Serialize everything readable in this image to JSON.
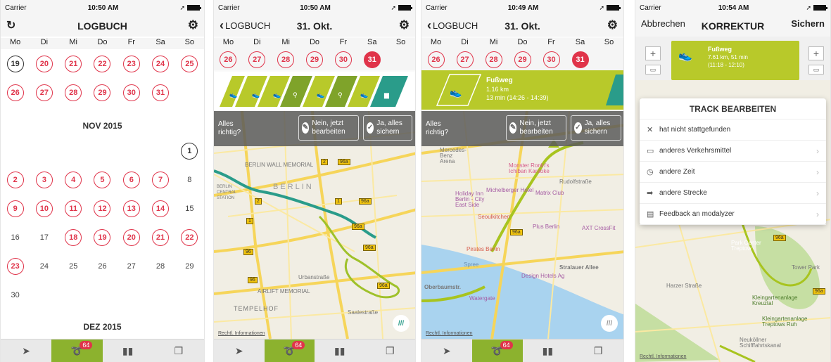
{
  "status": {
    "carrier": "Carrier",
    "times": [
      "10:50 AM",
      "10:50 AM",
      "10:49 AM",
      "10:54 AM"
    ]
  },
  "icons": {
    "refresh": "refresh-icon",
    "gear": "gear-icon",
    "back": "chevron-left-icon",
    "location": "location-icon",
    "track": "track-icon",
    "stats": "bar-chart-icon",
    "pages": "pages-icon"
  },
  "colors": {
    "accent_red": "#e0344a",
    "accent_green": "#8cb22e",
    "walk_green": "#b8c92a",
    "route_teal": "#2a9c8a"
  },
  "weekdays": [
    "Mo",
    "Di",
    "Mi",
    "Do",
    "Fr",
    "Sa",
    "So"
  ],
  "screen1": {
    "title": "LOGBUCH",
    "oct_rows": [
      [
        "19",
        "20",
        "21",
        "22",
        "23",
        "24",
        "25"
      ],
      [
        "26",
        "27",
        "28",
        "29",
        "30",
        "31",
        ""
      ]
    ],
    "nov_title": "NOV 2015",
    "nov_rows": [
      [
        "",
        "",
        "",
        "",
        "",
        "",
        "1"
      ],
      [
        "2",
        "3",
        "4",
        "5",
        "6",
        "7",
        "8"
      ],
      [
        "9",
        "10",
        "11",
        "12",
        "13",
        "14",
        "15"
      ],
      [
        "16",
        "17",
        "18",
        "19",
        "20",
        "21",
        "22"
      ],
      [
        "23",
        "24",
        "25",
        "26",
        "27",
        "28",
        "29"
      ],
      [
        "30",
        "",
        "",
        "",
        "",
        "",
        ""
      ]
    ],
    "dec_title": "DEZ 2015",
    "badge": "64"
  },
  "screen2": {
    "back": "LOGBUCH",
    "title": "31. Okt.",
    "days": [
      "26",
      "27",
      "28",
      "29",
      "30",
      "31"
    ],
    "question": "Alles richtig?",
    "btn_edit": "Nein, jetzt bearbeiten",
    "btn_save": "Ja, alles sichern",
    "map_labels": {
      "berlin": "BERLIN",
      "wall": "BERLIN WALL MEMORIAL",
      "central": "BERLIN CENTRAL STATION",
      "airlift": "AIRLIFT MEMORIAL",
      "tempelhof": "TEMPELHOF",
      "urbanstr": "Urbanstraße",
      "saalestr": "Saalestraße"
    },
    "credits": "Rechtl. Informationen",
    "badge": "64"
  },
  "screen3": {
    "back": "LOGBUCH",
    "title": "31. Okt.",
    "days": [
      "26",
      "27",
      "28",
      "29",
      "30",
      "31"
    ],
    "walk_title": "Fußweg",
    "walk_dist": "1.16 km",
    "walk_time": "13 min (14:26 - 14:39)",
    "question": "Alles richtig?",
    "btn_edit": "Nein, jetzt bearbeiten",
    "btn_save": "Ja, alles sichern",
    "map_labels": {
      "mercedes": "Mercedes-Benz Arena",
      "monster": "Monster Ronin's Ichiban Karaoke",
      "holiday": "Holiday Inn Berlin - City East Side",
      "michelberger": "Michelberger Hotel",
      "matrix": "Matrix Club",
      "seoul": "Seoulkitchen",
      "plus": "Plus Berlin",
      "axt": "AXT CrossFit",
      "pirates": "Pirates Berlin",
      "spree": "Spree",
      "design": "Design Hotels Ag",
      "stralauer": "Stralauer Allee",
      "oberbaum": "Oberbaumstr.",
      "watergate": "Watergate",
      "rudolf": "Rudolfstraße"
    },
    "credits": "Rechtl. Informationen",
    "badge": "64"
  },
  "screen4": {
    "cancel": "Abbrechen",
    "title": "KORREKTUR",
    "save": "Sichern",
    "card_title": "Fußweg",
    "card_info": "7.61 km, 51 min",
    "card_time": "(11:18 - 12:10)",
    "sheet_title": "TRACK BEARBEITEN",
    "items": [
      {
        "icon": "close-icon",
        "glyph": "✕",
        "label": "hat nicht stattgefunden"
      },
      {
        "icon": "vehicle-icon",
        "glyph": "▭",
        "label": "anderes Verkehrsmittel"
      },
      {
        "icon": "clock-icon",
        "glyph": "◷",
        "label": "andere Zeit"
      },
      {
        "icon": "arrow-right-icon",
        "glyph": "➡",
        "label": "andere Strecke"
      },
      {
        "icon": "feedback-icon",
        "glyph": "▤",
        "label": "Feedback an modalyzer"
      }
    ],
    "map_labels": {
      "park": "Park Center Treptow",
      "tower": "Tower Park",
      "kleingarten": "Kleingartenanlage Kreuztal",
      "treptow": "Kleingartenanlage Treptows Ruh",
      "harzer": "Harzer Straße",
      "schleuse": "Neuköllner Schifffahrtskanal"
    },
    "credits": "Rechtl. Informationen"
  }
}
